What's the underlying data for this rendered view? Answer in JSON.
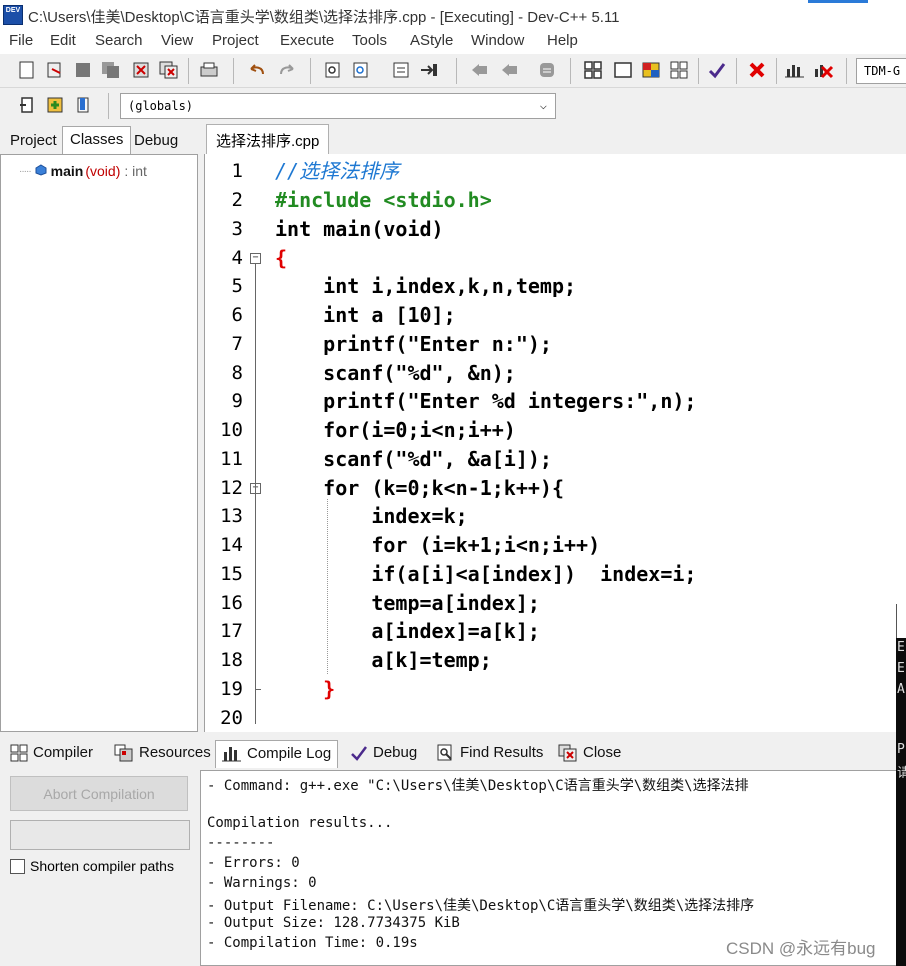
{
  "window": {
    "app_icon_text": "DEV",
    "title": "C:\\Users\\佳美\\Desktop\\C语言重头学\\数组类\\选择法排序.cpp - [Executing] - Dev-C++ 5.11"
  },
  "menu": [
    "File",
    "Edit",
    "Search",
    "View",
    "Project",
    "Execute",
    "Tools",
    "AStyle",
    "Window",
    "Help"
  ],
  "toolbar": {
    "compiler": "TDM-G",
    "scope_select": "(globals)"
  },
  "left_panel": {
    "tabs": [
      "Project",
      "Classes",
      "Debug"
    ],
    "active_tab": "Classes",
    "tree_item": {
      "name": "main",
      "signature": "(void)",
      "type": ": int"
    }
  },
  "editor": {
    "file_tab": "选择法排序.cpp",
    "line_numbers": [
      "1",
      "2",
      "3",
      "4",
      "5",
      "6",
      "7",
      "8",
      "9",
      "10",
      "11",
      "12",
      "13",
      "14",
      "15",
      "16",
      "17",
      "18",
      "19",
      "20"
    ],
    "lines": [
      "//选择法排序",
      "#include <stdio.h>",
      "int main(void)",
      "{",
      "    int i,index,k,n,temp;",
      "    int a [10];",
      "    printf(\"Enter n:\");",
      "    scanf(\"%d\", &n);",
      "    printf(\"Enter %d integers:\",n);",
      "    for(i=0;i<n;i++)",
      "    scanf(\"%d\", &a[i]);",
      "    for (k=0;k<n-1;k++){",
      "        index=k;",
      "        for (i=k+1;i<n;i++)",
      "        if(a[i]<a[index])  index=i;",
      "        temp=a[index];",
      "        a[index]=a[k];",
      "        a[k]=temp;",
      "    }",
      ""
    ]
  },
  "bottom_panel": {
    "tabs": [
      {
        "label": "Compiler",
        "icon": "grid-icon"
      },
      {
        "label": "Resources",
        "icon": "resources-icon"
      },
      {
        "label": "Compile Log",
        "icon": "chart-icon"
      },
      {
        "label": "Debug",
        "icon": "check-icon"
      },
      {
        "label": "Find Results",
        "icon": "find-icon"
      },
      {
        "label": "Close",
        "icon": "close-icon"
      }
    ],
    "active_tab": "Compile Log",
    "abort_label": "Abort Compilation",
    "shorten_label": "Shorten compiler paths",
    "log": [
      "- Command: g++.exe \"C:\\Users\\佳美\\Desktop\\C语言重头学\\数组类\\选择法排",
      "",
      "Compilation results...",
      "--------",
      "- Errors: 0",
      "- Warnings: 0",
      "- Output Filename: C:\\Users\\佳美\\Desktop\\C语言重头学\\数组类\\选择法排序",
      "- Output Size: 128.7734375 KiB",
      "- Compilation Time: 0.19s"
    ]
  },
  "console_sliver": [
    "E",
    "E",
    "A",
    "P",
    "请"
  ],
  "watermark": "CSDN @永远有bug"
}
